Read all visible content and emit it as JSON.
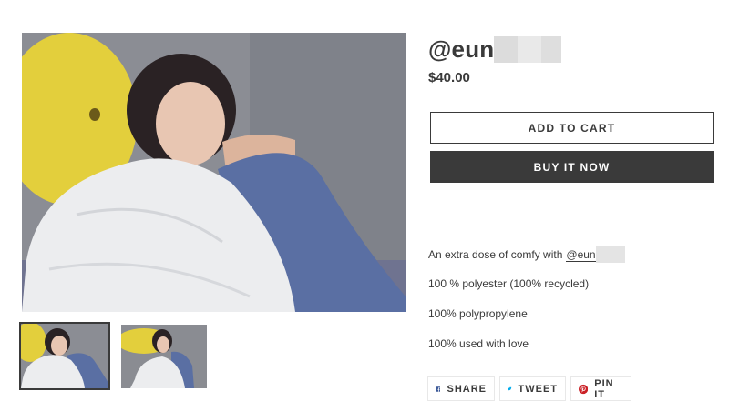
{
  "product": {
    "title": "@eun",
    "price": "$40.00",
    "add_to_cart_label": "ADD TO CART",
    "buy_now_label": "BUY IT NOW"
  },
  "description": {
    "line1_prefix": "An extra dose of comfy with",
    "line1_mention": "@eun",
    "line2": "100 % polyester (100% recycled)",
    "line3": "100% polypropylene",
    "line4": "100% used with love"
  },
  "share": {
    "facebook_label": "SHARE",
    "twitter_label": "TWEET",
    "pinterest_label": "PIN IT"
  },
  "colors": {
    "text": "#3a3a3a",
    "button_dark": "#3a3a3a",
    "facebook": "#3b5998",
    "twitter": "#00aced",
    "pinterest": "#cb2127"
  },
  "icons": [
    "facebook-icon",
    "twitter-icon",
    "pinterest-icon"
  ]
}
